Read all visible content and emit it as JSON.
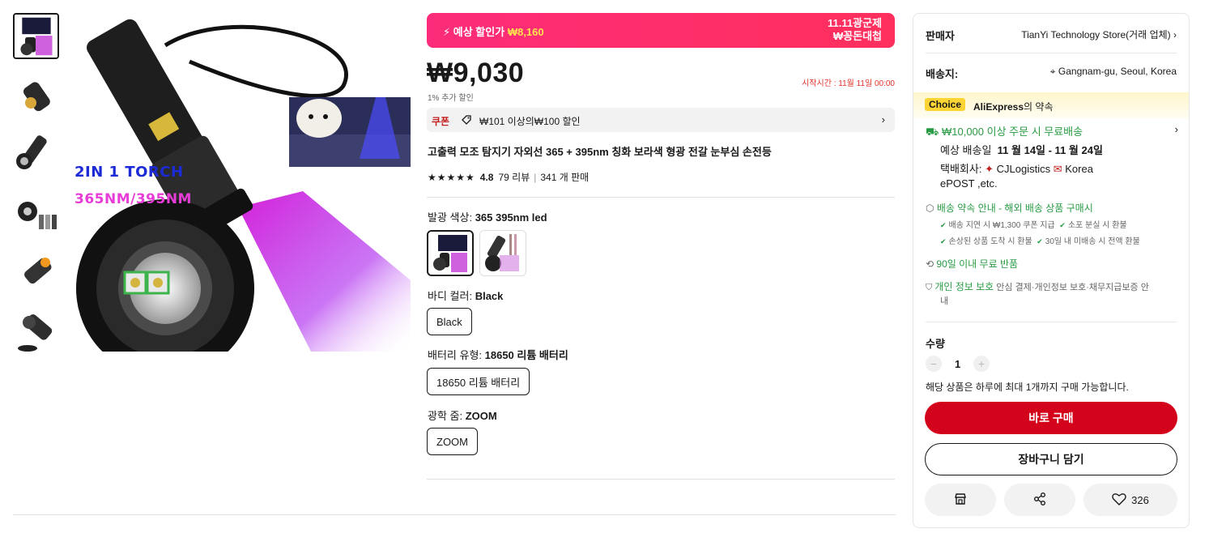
{
  "gallery": {
    "thumbnails": [
      "thumb-1",
      "thumb-2",
      "thumb-3",
      "thumb-4",
      "thumb-5",
      "thumb-6"
    ],
    "main_image_text_1": "2IN 1 TORCH",
    "main_image_text_2": "365NM/395NM"
  },
  "promo": {
    "label": "예상 할인가",
    "price": "₩8,160",
    "event_line1": "11.11광군제",
    "event_line2": "₩꽁돈대첩"
  },
  "price": {
    "main": "₩9,030",
    "extra_discount": "1% 추가 할인",
    "start_time": "시작시간 :  11월 11일 00:00"
  },
  "coupon": {
    "label": "쿠폰",
    "text": "₩101 이상의₩100 할인"
  },
  "product": {
    "title": "고출력 모조 탐지기 자외선 365 + 395nm 칭화 보라색 형광 전갈 눈부심 손전등",
    "stars": "★★★★★",
    "rating": "4.8",
    "reviews": "79 리뷰",
    "sold": "341 개 판매"
  },
  "options": {
    "color_label": "발광 색상: ",
    "color_value": "365 395nm led",
    "body_label": "바디 컬러: ",
    "body_value": "Black",
    "body_option": "Black",
    "battery_label": "배터리 유형: ",
    "battery_value": "18650 리튬 배터리",
    "battery_option": "18650 리튬 배터리",
    "zoom_label": "광학 줌: ",
    "zoom_value": "ZOOM",
    "zoom_option": "ZOOM"
  },
  "panel": {
    "seller_key": "판매자",
    "seller_value": "TianYi Technology Store(거래 업체)",
    "ship_key": "배송지:",
    "ship_value": "Gangnam-gu, Seoul, Korea",
    "choice_badge": "Choice",
    "choice_text_brand": "AliExpress",
    "choice_text_rest": "의 약속",
    "free_ship": "₩10,000 이상 주문 시 무료배송",
    "delivery_prefix": "예상 배송일",
    "delivery_dates": "11 월 14일 - 11 월 24일",
    "carrier_prefix": "택배회사:",
    "carrier_1": "CJLogistics",
    "carrier_2": "Korea",
    "carrier_3": "ePOST ,etc.",
    "promise_title": "배송 약속 안내 - 해외 배송 상품 구매시",
    "promise_1": "배송 지연 시 ₩1,300 쿠폰 지급",
    "promise_2": "소포 분실 시 환불",
    "promise_3": "손상된 상품 도착 시 환불",
    "promise_4": "30일 내 미배송 시 전액 환불",
    "return_text": "90일 이내 무료 반품",
    "privacy_title": "개인 정보 보호",
    "privacy_text": "안심 결제·개인정보 보호·채무지급보증 안",
    "privacy_text_2": "내",
    "qty_label": "수량",
    "qty_value": "1",
    "qty_limit": "해당 상품은 하루에 최대 1개까지 구매 가능합니다.",
    "buy_now": "바로 구매",
    "add_cart": "장바구니 담기",
    "wishlist_count": "326"
  },
  "colors": {
    "accent_red": "#d3031c",
    "promo_pink": "#fd2c7a",
    "green": "#2a9b45",
    "choice_yellow": "#fcd535"
  }
}
